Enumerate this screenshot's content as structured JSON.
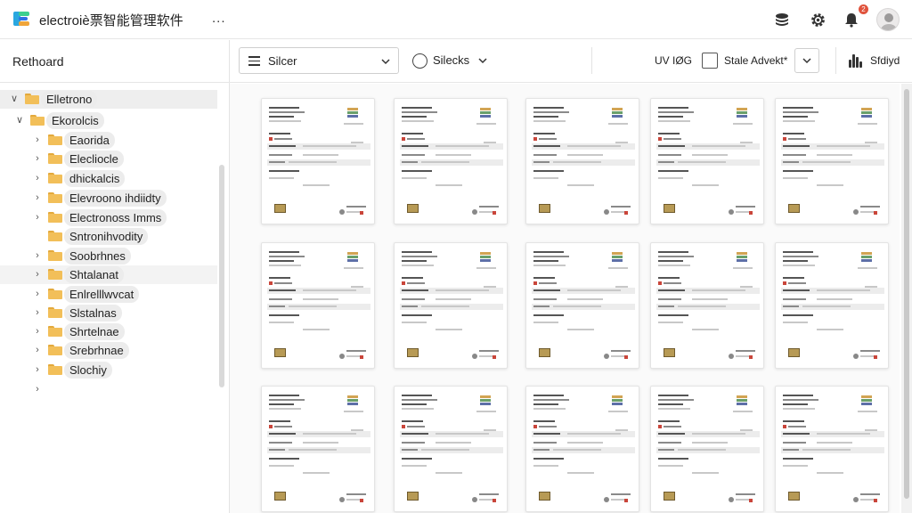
{
  "app": {
    "title": "electroiè票智能管理软件",
    "more_label": "...",
    "notification_count": "2",
    "colors": {
      "accent_blue": "#1a73e8",
      "folder": "#f2bf59",
      "badge": "#e0533d"
    },
    "icons": [
      "app-logo-icon",
      "layers-icon",
      "gear-icon",
      "bell-icon",
      "user-avatar-icon"
    ]
  },
  "sidebar": {
    "title": "Rethoard",
    "items": [
      {
        "label": "Elletrono",
        "expanded": true,
        "chevron": "∨"
      },
      {
        "label": "Ekorolcis",
        "expanded": true,
        "chevron": "∨"
      },
      {
        "label": "Eaorida",
        "chevron": "›"
      },
      {
        "label": "Elecliocle",
        "chevron": "›"
      },
      {
        "label": "dhickalcis",
        "chevron": "›"
      },
      {
        "label": "Elevroono ihdiidty",
        "chevron": "›"
      },
      {
        "label": "Electronoss Imms",
        "chevron": "›"
      },
      {
        "label": "Sntronihvodity",
        "chevron": ""
      },
      {
        "label": "Soobrhnes",
        "chevron": "›"
      },
      {
        "label": "Shtalanat",
        "chevron": "›"
      },
      {
        "label": "Enlrelllwvcat",
        "chevron": "›"
      },
      {
        "label": "Slstalnas",
        "chevron": "›"
      },
      {
        "label": "Shrtelnae",
        "chevron": "›"
      },
      {
        "label": "Srebrhnae",
        "chevron": "›"
      },
      {
        "label": "Slochiy",
        "chevron": "›"
      },
      {
        "label": "",
        "chevron": "›"
      }
    ]
  },
  "toolbar": {
    "select1_label": "Silcer",
    "select2_label": "Silecks",
    "view_label": "UV IØG",
    "scale_label": "Stale Advekt*",
    "split_label": "Sfdiyd"
  }
}
